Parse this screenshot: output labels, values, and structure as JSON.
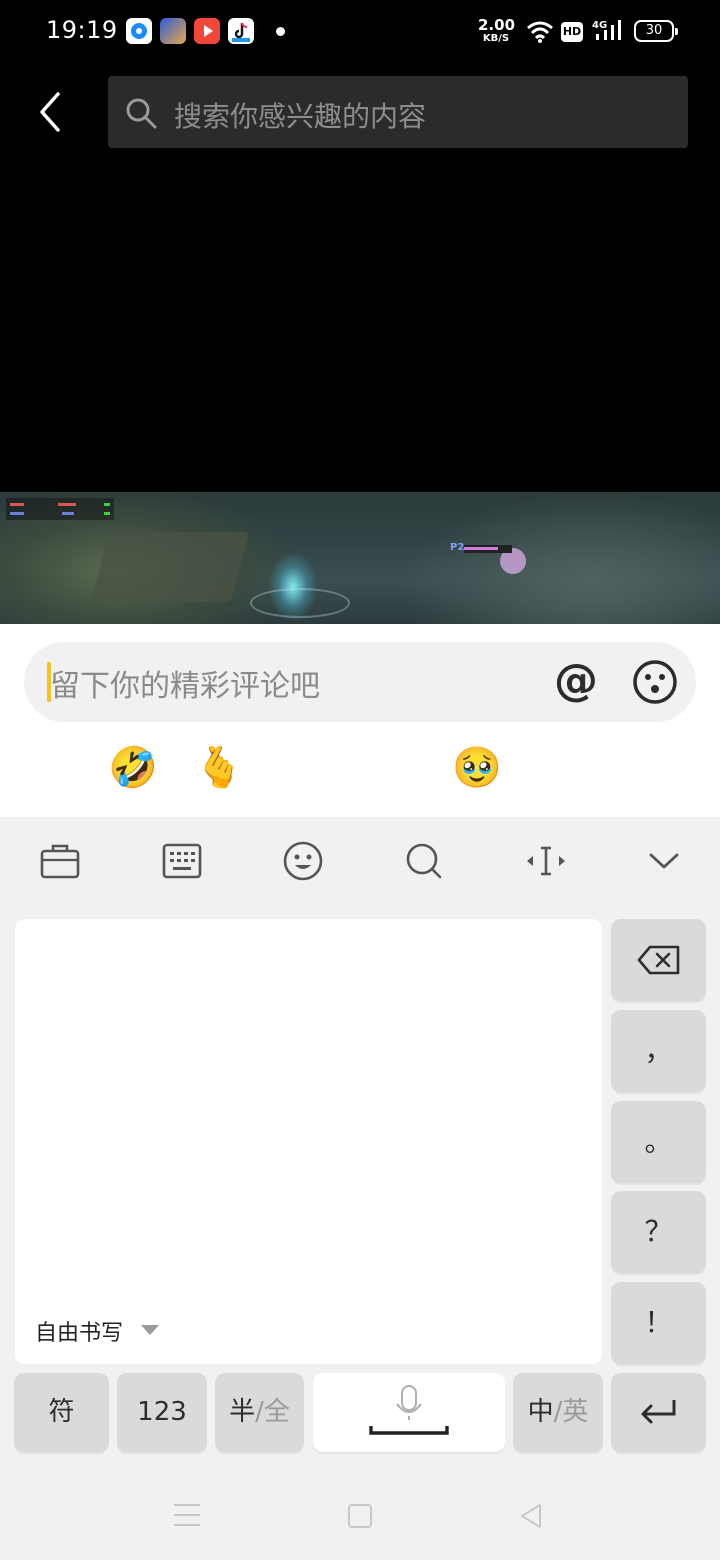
{
  "status_bar": {
    "time": "19:19",
    "net_speed_value": "2.00",
    "net_speed_unit": "KB/S",
    "hd_label": "HD",
    "network_label": "4G",
    "battery": "30",
    "app_icons": [
      "maps-app-icon",
      "game-app-icon",
      "video-app-icon",
      "douyin-app-icon"
    ]
  },
  "header": {
    "search_placeholder": "搜索你感兴趣的内容"
  },
  "comment": {
    "placeholder": "留下你的精彩评论吧",
    "at_label": "@",
    "quick_emojis": [
      "😭",
      "🤣",
      "🫰",
      "☕",
      "🙀",
      "🥹",
      "😡",
      "😆"
    ]
  },
  "keyboard": {
    "toolbar": [
      "briefcase-icon",
      "keyboard-icon",
      "smiley-icon",
      "search-icon",
      "cursor-move-icon",
      "chevron-down-icon"
    ],
    "handwriting_mode": "自由书写",
    "side_keys": {
      "comma": "，",
      "period": "。",
      "question": "？",
      "exclaim": "！"
    },
    "bottom_keys": {
      "symbol": "符",
      "numbers": "123",
      "half": "半",
      "full": "/全",
      "chinese": "中",
      "english": "/英"
    }
  },
  "colors": {
    "caret": "#f2c41c",
    "search_bg": "#2b2b2b",
    "keyboard_bg": "#f1f1f3"
  }
}
